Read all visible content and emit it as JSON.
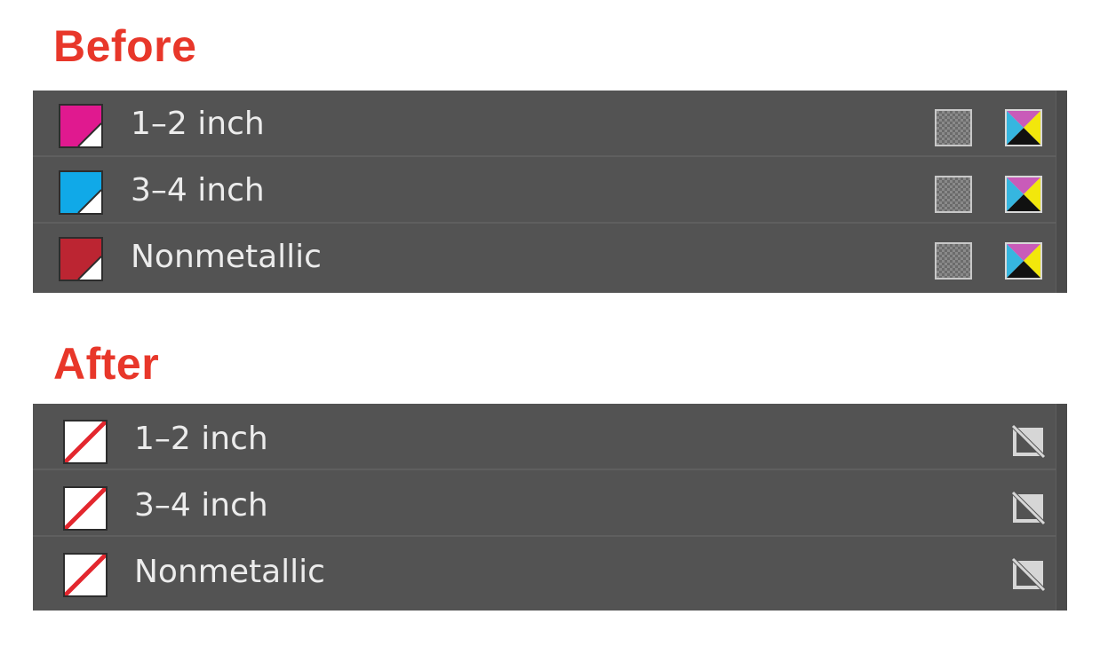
{
  "before": {
    "title": "Before",
    "rows": [
      {
        "label": "1–2 inch",
        "swatch_color": "#e0198f",
        "tint_icon": "checker-tint-icon",
        "mode_icon": "cmyk-process-icon"
      },
      {
        "label": "3–4 inch",
        "swatch_color": "#10a9e8",
        "tint_icon": "checker-tint-icon",
        "mode_icon": "cmyk-process-icon"
      },
      {
        "label": "Nonmetallic",
        "swatch_color": "#bc2532",
        "tint_icon": "checker-tint-icon",
        "mode_icon": "cmyk-process-icon"
      }
    ]
  },
  "after": {
    "title": "After",
    "rows": [
      {
        "label": "1–2 inch",
        "swatch_icon": "none-swatch-icon",
        "status_icon": "non-editable-icon"
      },
      {
        "label": "3–4 inch",
        "swatch_icon": "none-swatch-icon",
        "status_icon": "non-editable-icon"
      },
      {
        "label": "Nonmetallic",
        "swatch_icon": "none-swatch-icon",
        "status_icon": "non-editable-icon"
      }
    ]
  },
  "colors": {
    "heading": "#e8372a",
    "panel_bg": "#535353",
    "row_text": "#ececec",
    "none_slash": "#e3272e"
  }
}
